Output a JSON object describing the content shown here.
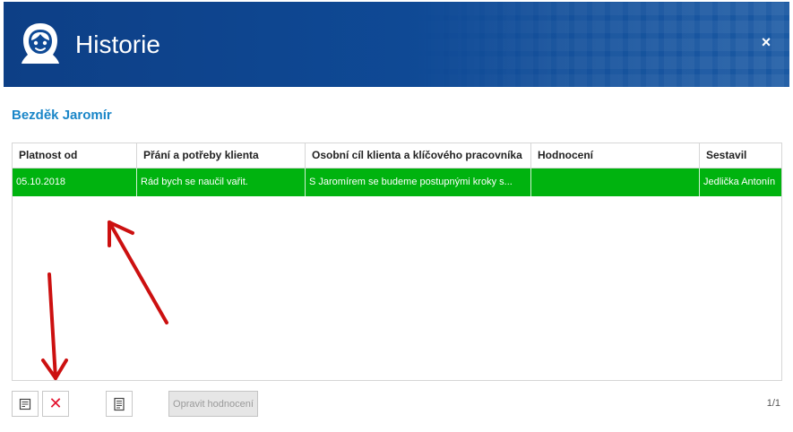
{
  "window": {
    "title": "Historie",
    "close_glyph": "×",
    "logo_icon": "person-face-icon"
  },
  "client": {
    "name": "Bezděk Jaromír"
  },
  "table": {
    "columns": [
      "Platnost od",
      "Přání a potřeby klienta",
      "Osobní cíl klienta a klíčového pracovníka",
      "Hodnocení",
      "Sestavil"
    ],
    "rows": [
      {
        "platnost_od": "05.10.2018",
        "prani": "Rád bych se naučil vařit.",
        "osobni_cil": "S Jaromírem se budeme postupnými kroky s...",
        "hodnoceni": "",
        "sestavil": "Jedlička Antonín",
        "highlight_color": "#00b30f"
      }
    ]
  },
  "toolbar": {
    "edit_icon": "edit-document-icon",
    "delete_icon": "delete-x-icon",
    "delete_glyph": "✕",
    "detail_icon": "document-icon",
    "fix_rating_label": "Opravit hodnocení"
  },
  "pager": {
    "text": "1/1"
  },
  "colors": {
    "header": "#0f4a96",
    "accent": "#1a86c8",
    "selected_row": "#00b30f",
    "delete": "#e3122e",
    "annotation_arrow": "#cc1010"
  }
}
